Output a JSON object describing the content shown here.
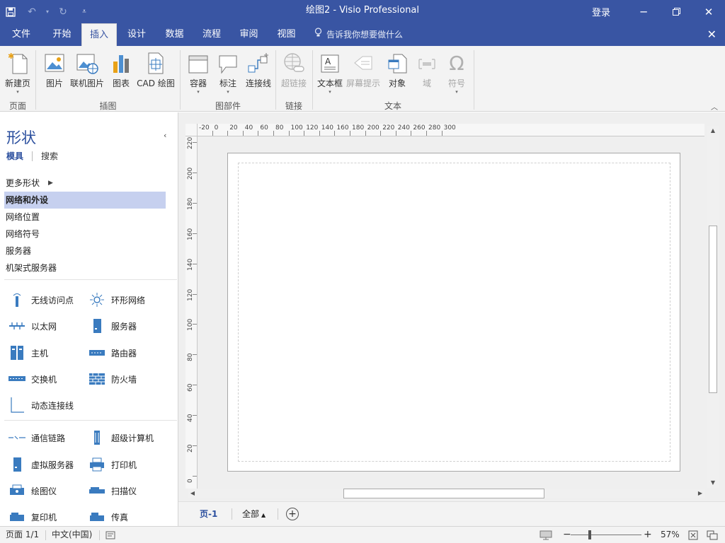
{
  "titlebar": {
    "title": "绘图2 - Visio Professional",
    "signin": "登录",
    "save_icon": "save-icon",
    "undo_icon": "undo-icon",
    "redo_icon": "redo-icon",
    "customize_icon": "customize-qat-icon"
  },
  "tabs": {
    "file": "文件",
    "home": "开始",
    "insert": "插入",
    "design": "设计",
    "data": "数据",
    "process": "流程",
    "review": "审阅",
    "view": "视图",
    "tellme": "告诉我你想要做什么"
  },
  "ribbon": {
    "new_page": "新建页",
    "picture": "图片",
    "online_picture": "联机图片",
    "chart": "图表",
    "cad": "CAD 绘图",
    "container": "容器",
    "callout": "标注",
    "connector": "连接线",
    "hyperlink": "超链接",
    "textbox": "文本框",
    "screentip": "屏幕提示",
    "object": "对象",
    "field": "域",
    "symbol": "符号",
    "groups": {
      "pages": "页面",
      "illustrations": "插图",
      "diagram_parts": "图部件",
      "links": "链接",
      "text": "文本"
    }
  },
  "shapes_pane": {
    "title": "形状",
    "tab_stencils": "模具",
    "tab_search": "搜索",
    "more_shapes": "更多形状",
    "stencils": [
      "网络和外设",
      "网络位置",
      "网络符号",
      "服务器",
      "机架式服务器"
    ],
    "shapes": {
      "wap": "无线访问点",
      "ring": "环形网络",
      "ethernet": "以太网",
      "server": "服务器",
      "mainframe": "主机",
      "router": "路由器",
      "switch": "交换机",
      "firewall": "防火墙",
      "dynamic_connector": "动态连接线",
      "comm_link": "通信链路",
      "supercomputer": "超级计算机",
      "virtual_server": "虚拟服务器",
      "printer": "打印机",
      "plotter": "绘图仪",
      "scanner": "扫描仪",
      "copier": "复印机",
      "fax": "传真"
    }
  },
  "rulers": {
    "h_labels": [
      "-20",
      "0",
      "20",
      "40",
      "60",
      "80",
      "100",
      "120",
      "140",
      "160",
      "180",
      "200",
      "220",
      "240",
      "260",
      "280",
      "300"
    ],
    "v_labels": [
      "220",
      "200",
      "180",
      "160",
      "140",
      "120",
      "100",
      "80",
      "60",
      "40",
      "20",
      "0"
    ]
  },
  "pagetabs": {
    "page1": "页-1",
    "all": "全部"
  },
  "statusbar": {
    "page": "页面 1/1",
    "language": "中文(中国)",
    "zoom": "57%"
  },
  "colors": {
    "accent": "#3955a3",
    "selected_stencil": "#c6d0ef",
    "pane_title": "#2b4f9e"
  }
}
